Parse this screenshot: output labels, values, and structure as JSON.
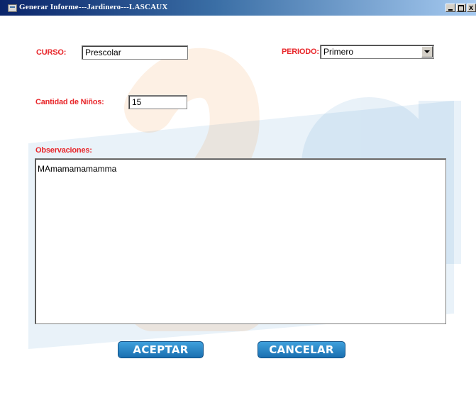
{
  "window": {
    "title": "Generar Informe---Jardinero---LASCAUX",
    "close_glyph": "x"
  },
  "form": {
    "curso_label": "CURSO:",
    "curso_value": "Prescolar",
    "periodo_label": "PERIODO:",
    "periodo_selected": "Primero",
    "cantidad_label": "Cantidad de Niños:",
    "cantidad_value": "15",
    "observaciones_label": "Observaciones:",
    "observaciones_value": "MAmamamamamma"
  },
  "buttons": {
    "aceptar_label": "ACEPTAR",
    "cancelar_label": "CANCELAR"
  },
  "colors": {
    "label_red": "#e8262a",
    "button_blue": "#1a6fb0",
    "titlebar_start": "#0a246a",
    "titlebar_end": "#a6caf0"
  },
  "icons": {
    "app": "window-app-icon",
    "minimize": "minimize-icon",
    "maximize": "maximize-icon",
    "close": "close-icon",
    "dropdown": "chevron-down-icon"
  }
}
